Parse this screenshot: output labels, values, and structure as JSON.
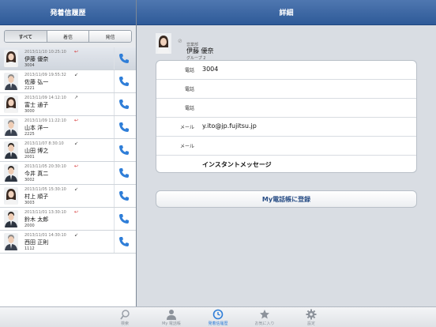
{
  "left_header": {
    "title": "発着信履歴"
  },
  "right_header": {
    "title": "詳細"
  },
  "segments": [
    "すべて",
    "着信",
    "発信"
  ],
  "history": [
    {
      "time": "2013/11/10 10:25:10",
      "dir": "missed",
      "dir_icon": "missed-call-icon",
      "name": "伊藤 優奈",
      "number": "3004",
      "avatar": "female"
    },
    {
      "time": "2013/11/09 19:55:32",
      "dir": "incoming",
      "dir_icon": "incoming-call-icon",
      "name": "佐藤 弘一",
      "number": "2221",
      "avatar": "male-gray"
    },
    {
      "time": "2013/11/09 14:12:10",
      "dir": "outgoing",
      "dir_icon": "outgoing-call-icon",
      "name": "富士 通子",
      "number": "3000",
      "avatar": "female"
    },
    {
      "time": "2013/11/09 11:22:10",
      "dir": "missed",
      "dir_icon": "missed-call-icon",
      "name": "山本 洋一",
      "number": "2225",
      "avatar": "male-gray"
    },
    {
      "time": "2013/11/07 8:30:10",
      "dir": "incoming",
      "dir_icon": "incoming-call-icon",
      "name": "山田 博之",
      "number": "2001",
      "avatar": "male"
    },
    {
      "time": "2013/11/05 20:30:10",
      "dir": "missed",
      "dir_icon": "missed-call-icon",
      "name": "今井 真二",
      "number": "3002",
      "avatar": "male"
    },
    {
      "time": "2013/11/05 15:30:10",
      "dir": "incoming",
      "dir_icon": "incoming-call-icon",
      "name": "村上 順子",
      "number": "3003",
      "avatar": "female"
    },
    {
      "time": "2013/11/01 13:30:10",
      "dir": "missed",
      "dir_icon": "missed-call-icon",
      "name": "鈴木 太郎",
      "number": "2000",
      "avatar": "male"
    },
    {
      "time": "2013/11/01 14:30:10",
      "dir": "incoming",
      "dir_icon": "incoming-call-icon",
      "name": "西田 正則",
      "number": "1112",
      "avatar": "male-gray"
    }
  ],
  "contact": {
    "dept": "営業部",
    "name": "伊藤 優奈",
    "group": "グループ 2"
  },
  "details": [
    {
      "label": "電話",
      "value": "3004"
    },
    {
      "label": "電話",
      "value": ""
    },
    {
      "label": "電話",
      "value": ""
    },
    {
      "label": "メール",
      "value": "y.ito@jp.fujitsu.jp"
    },
    {
      "label": "メール",
      "value": ""
    },
    {
      "label": "",
      "value": "インスタントメッセージ"
    }
  ],
  "register_button": "My電話帳に登録",
  "tabs": [
    {
      "label": "検索",
      "icon": "search-icon",
      "active": false
    },
    {
      "label": "My 電話帳",
      "icon": "person-icon",
      "active": false
    },
    {
      "label": "発着信履歴",
      "icon": "clock-icon",
      "active": true
    },
    {
      "label": "お気に入り",
      "icon": "star-icon",
      "active": false
    },
    {
      "label": "設定",
      "icon": "gear-icon",
      "active": false
    }
  ],
  "colors": {
    "header": "#3a66a4",
    "accent": "#2f7ed8",
    "missed": "#d43030"
  }
}
